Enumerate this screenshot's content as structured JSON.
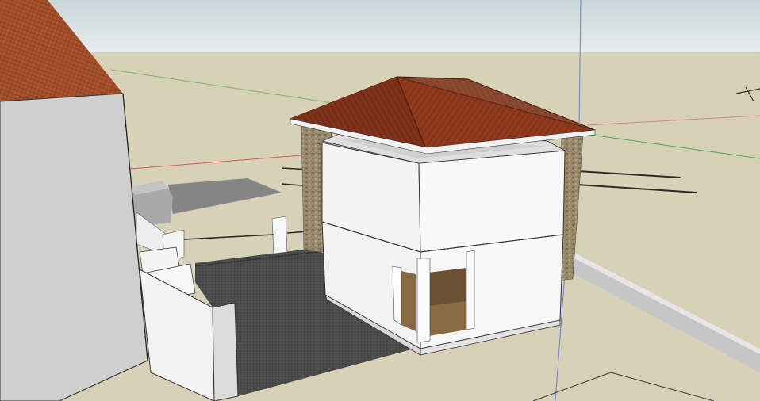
{
  "viewport": {
    "sky_top_color": "#c9d6d8",
    "sky_bottom_color": "#e9eeee",
    "ground_color": "#d7d2b7",
    "axis_red_color": "#d65a5a",
    "axis_green_color": "#4faa4f",
    "axis_blue_color": "#6f7fd8"
  },
  "scene": {
    "roof_color": "#8f3a1e",
    "roof_shade_color": "#6b2a12",
    "wall_white": "#f4f4f4",
    "wall_shade": "#dedede",
    "stone_color": "#9a8a6c",
    "pavement_color": "#4a4a4a",
    "floor_wood_color": "#8a6a43",
    "left_building_wall": "#cfcfcf",
    "shadow_color": "#858585"
  }
}
